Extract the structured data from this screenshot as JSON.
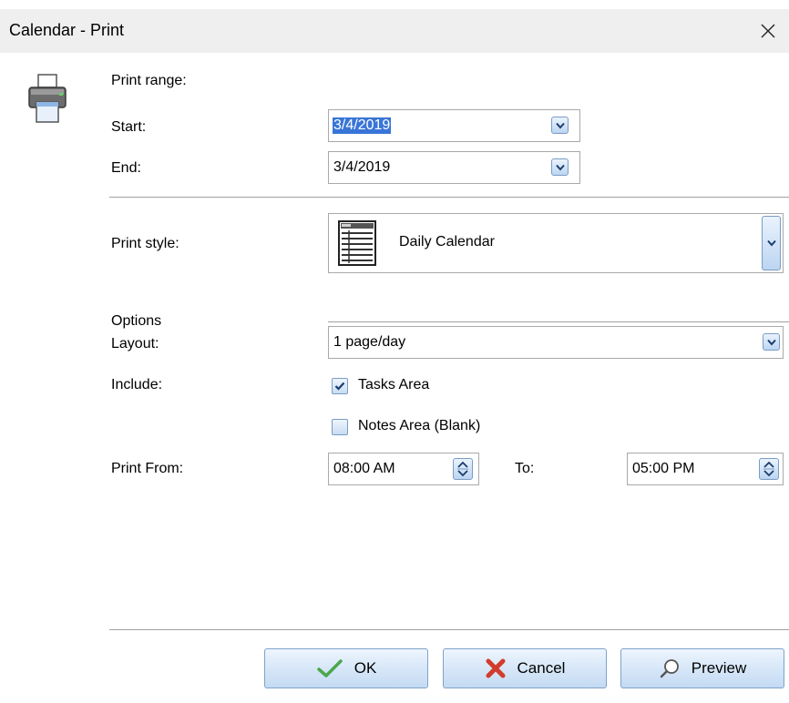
{
  "window": {
    "title": "Calendar - Print",
    "close_glyph": "✕"
  },
  "print_range": {
    "heading": "Print range:",
    "start_label": "Start:",
    "start_value": "3/4/2019",
    "end_label": "End:",
    "end_value": "3/4/2019"
  },
  "print_style": {
    "label": "Print style:",
    "value": "Daily Calendar",
    "icon": "daily-calendar-icon"
  },
  "options": {
    "heading": "Options",
    "layout_label": "Layout:",
    "layout_value": "1 page/day",
    "include_label": "Include:",
    "tasks_area_label": "Tasks Area",
    "tasks_area_checked": true,
    "notes_area_label": "Notes Area (Blank)",
    "notes_area_checked": false,
    "print_from_label": "Print From:",
    "print_from_value": "08:00 AM",
    "to_label": "To:",
    "to_value": "05:00 PM"
  },
  "buttons": {
    "ok": "OK",
    "cancel": "Cancel",
    "preview": "Preview"
  },
  "colors": {
    "titlebar": "#efefef",
    "accent": "#3875d7",
    "button_border": "#7ea2c9",
    "check_green": "#4ca64c",
    "cancel_red": "#d33b2c"
  }
}
